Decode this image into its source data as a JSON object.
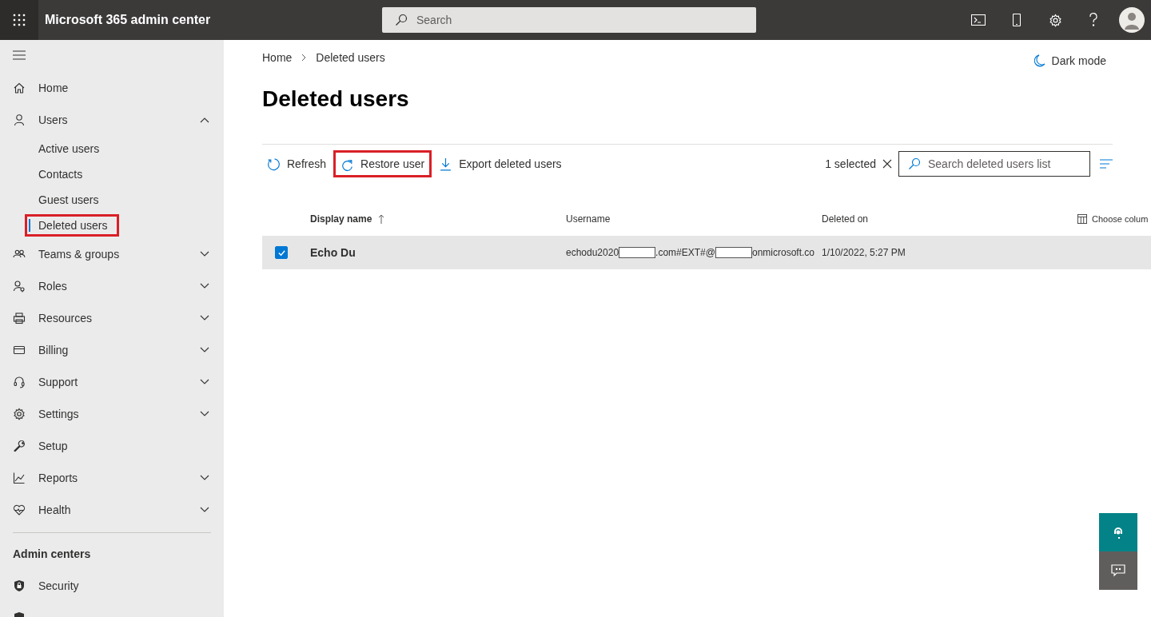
{
  "header": {
    "title": "Microsoft 365 admin center",
    "search": {
      "placeholder": "Search"
    }
  },
  "sidebar": {
    "items": [
      {
        "label": "Home",
        "kind": "link"
      },
      {
        "label": "Users",
        "kind": "group",
        "expanded": true,
        "children": [
          {
            "label": "Active users",
            "selected": false,
            "highlighted": false
          },
          {
            "label": "Contacts",
            "selected": false,
            "highlighted": false
          },
          {
            "label": "Guest users",
            "selected": false,
            "highlighted": false
          },
          {
            "label": "Deleted users",
            "selected": true,
            "highlighted": true
          }
        ]
      },
      {
        "label": "Teams & groups",
        "kind": "group",
        "expanded": false
      },
      {
        "label": "Roles",
        "kind": "group",
        "expanded": false
      },
      {
        "label": "Resources",
        "kind": "group",
        "expanded": false
      },
      {
        "label": "Billing",
        "kind": "group",
        "expanded": false
      },
      {
        "label": "Support",
        "kind": "group",
        "expanded": false
      },
      {
        "label": "Settings",
        "kind": "group",
        "expanded": false
      },
      {
        "label": "Setup",
        "kind": "link"
      },
      {
        "label": "Reports",
        "kind": "group",
        "expanded": false
      },
      {
        "label": "Health",
        "kind": "group",
        "expanded": false
      }
    ],
    "section_title": "Admin centers",
    "admin_items": [
      {
        "label": "Security"
      }
    ]
  },
  "breadcrumb": [
    "Home",
    "Deleted users"
  ],
  "dark_mode": "Dark mode",
  "page_title": "Deleted users",
  "toolbar": {
    "actions": [
      {
        "label": "Refresh",
        "highlighted": false
      },
      {
        "label": "Restore user",
        "highlighted": true
      },
      {
        "label": "Export deleted users",
        "highlighted": false
      }
    ],
    "selection": "1 selected",
    "search": {
      "placeholder": "Search deleted users list"
    }
  },
  "table": {
    "columns": [
      {
        "label": "Display name",
        "sorted": true
      },
      {
        "label": "Username",
        "sorted": false
      },
      {
        "label": "Deleted on",
        "sorted": false
      }
    ],
    "choose_columns": "Choose colum",
    "rows": [
      {
        "selected": true,
        "display_name": "Echo Du",
        "username_parts": [
          "echodu2020",
          ".com#EXT#@",
          "onmicrosoft.co"
        ],
        "deleted_on": "1/10/2022, 5:27 PM"
      }
    ]
  }
}
